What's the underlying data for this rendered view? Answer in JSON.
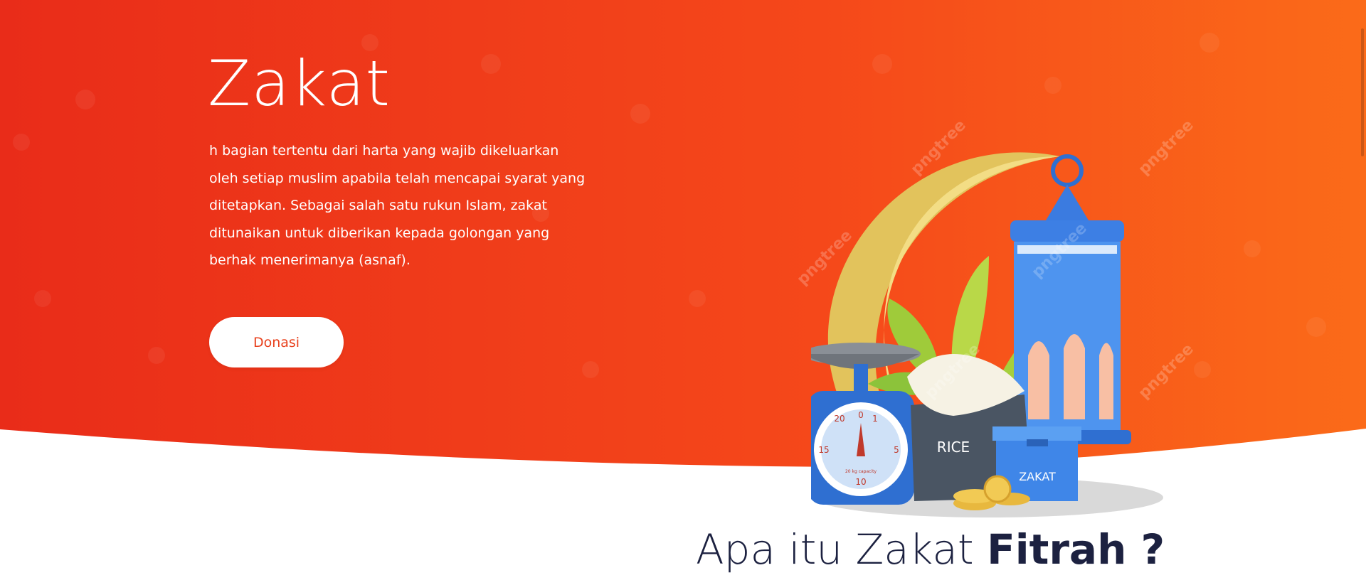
{
  "hero": {
    "title": "Zakat",
    "description": "h bagian tertentu dari harta yang wajib dikeluarkan oleh setiap muslim apabila telah mencapai syarat yang ditetapkan. Sebagai salah satu rukun Islam, zakat ditunaikan untuk diberikan kepada golongan yang berhak menerimanya (asnaf).",
    "button_label": "Donasi",
    "colors": {
      "gradient_start": "#ea2d1a",
      "gradient_end": "#fb6a19",
      "button_text": "#e8401c"
    }
  },
  "illustration": {
    "scale_label": "20 kg capacity",
    "scale_numbers": [
      "0",
      "1",
      "5",
      "10",
      "15",
      "20"
    ],
    "rice_label": "RICE",
    "box_label": "ZAKAT",
    "watermark_text": "pngtree"
  },
  "section": {
    "heading_light": "Apa itu Zakat",
    "heading_bold": "Fitrah ?"
  }
}
